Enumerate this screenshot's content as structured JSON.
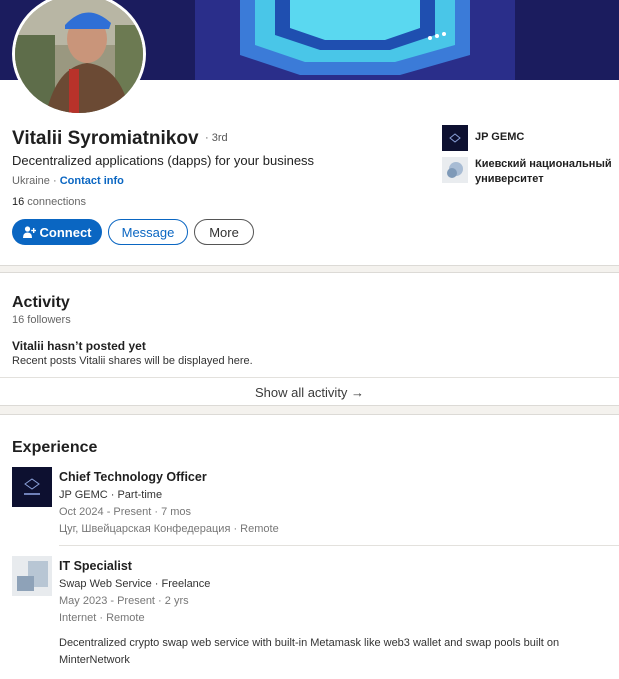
{
  "profile": {
    "name": "Vitalii Syromiatnikov",
    "degree": "· 3rd",
    "headline": "Decentralized applications (dapps) for your business",
    "location": "Ukraine · ",
    "contact_info": "Contact info",
    "connections_count": "16",
    "connections_label": " connections",
    "buttons": {
      "connect": "Connect",
      "message": "Message",
      "more": "More"
    },
    "organizations": [
      {
        "name": "JP GEMC",
        "icon": "company-logo"
      },
      {
        "name_line1": "Киевский национальный",
        "name_line2": "университет",
        "icon": "school-logo"
      }
    ]
  },
  "activity": {
    "title": "Activity",
    "followers": "16 followers",
    "empty_title": "Vitalii hasn’t posted yet",
    "empty_desc": "Recent posts Vitalii shares will be displayed here.",
    "show_all": "Show all activity →"
  },
  "experience": {
    "title": "Experience",
    "items": [
      {
        "role": "Chief Technology Officer",
        "company": "JP GEMC · Part-time",
        "dates": "Oct 2024 - Present · 7 mos",
        "location": "Цуг, Швейцарская Конфедерация · Remote"
      },
      {
        "role": "IT Specialist",
        "company": "Swap Web Service · Freelance",
        "dates": "May 2023 - Present · 2 yrs",
        "location": "Internet · Remote",
        "description": "Decentralized crypto swap web service with built-in Metamask like web3 wallet and swap pools built on MinterNetwork"
      }
    ]
  },
  "colors": {
    "accent": "#0a66c2",
    "banner": "#1b1c5e",
    "page_bg": "#f4f2ee"
  }
}
